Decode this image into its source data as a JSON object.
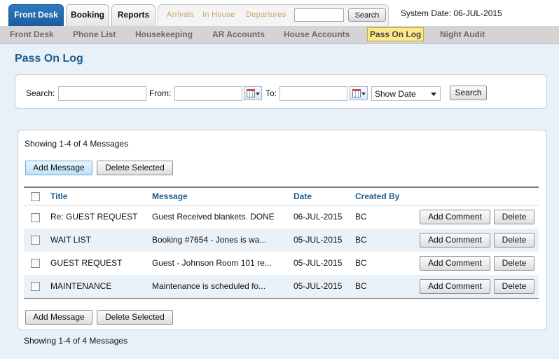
{
  "top_tabs": [
    "Front Desk",
    "Booking",
    "Reports"
  ],
  "sub_links": [
    "Arrivals",
    "In House",
    "Departures"
  ],
  "top_search": {
    "value": "",
    "button": "Search"
  },
  "system_date": "System Date: 06-JUL-2015",
  "nav": [
    "Front Desk",
    "Phone List",
    "Housekeeping",
    "AR Accounts",
    "House Accounts",
    "Pass On Log",
    "Night Audit"
  ],
  "nav_active": "Pass On Log",
  "page_title": "Pass On Log",
  "filter": {
    "search_label": "Search:",
    "search_value": "",
    "from_label": "From:",
    "from_value": "",
    "to_label": "To:",
    "to_value": "",
    "select_value": "Show Date",
    "search_button": "Search"
  },
  "showing_text": "Showing 1-4 of 4 Messages",
  "buttons": {
    "add_message": "Add Message",
    "delete_selected": "Delete Selected",
    "add_comment": "Add Comment",
    "delete": "Delete"
  },
  "columns": [
    "Title",
    "Message",
    "Date",
    "Created By"
  ],
  "rows": [
    {
      "title": "Re: GUEST REQUEST",
      "message": "Guest Received blankets. DONE",
      "date": "06-JUL-2015",
      "created_by": "BC"
    },
    {
      "title": "WAIT LIST",
      "message": "Booking #7654 - Jones is wa...",
      "date": "05-JUL-2015",
      "created_by": "BC"
    },
    {
      "title": "GUEST REQUEST",
      "message": "Guest - Johnson Room 101 re...",
      "date": "05-JUL-2015",
      "created_by": "BC"
    },
    {
      "title": "MAINTENANCE",
      "message": "Maintenance is scheduled fo...",
      "date": "05-JUL-2015",
      "created_by": "BC"
    }
  ],
  "colors": {
    "accent": "#1e5c8c",
    "active_tab": "#1a5d9e",
    "nav_highlight": "#fde98a",
    "page_bg": "#e8f0f8",
    "alt_row": "#eaf2f9"
  },
  "icons": [
    "calendar-icon",
    "dropdown-caret-icon",
    "checkbox"
  ]
}
